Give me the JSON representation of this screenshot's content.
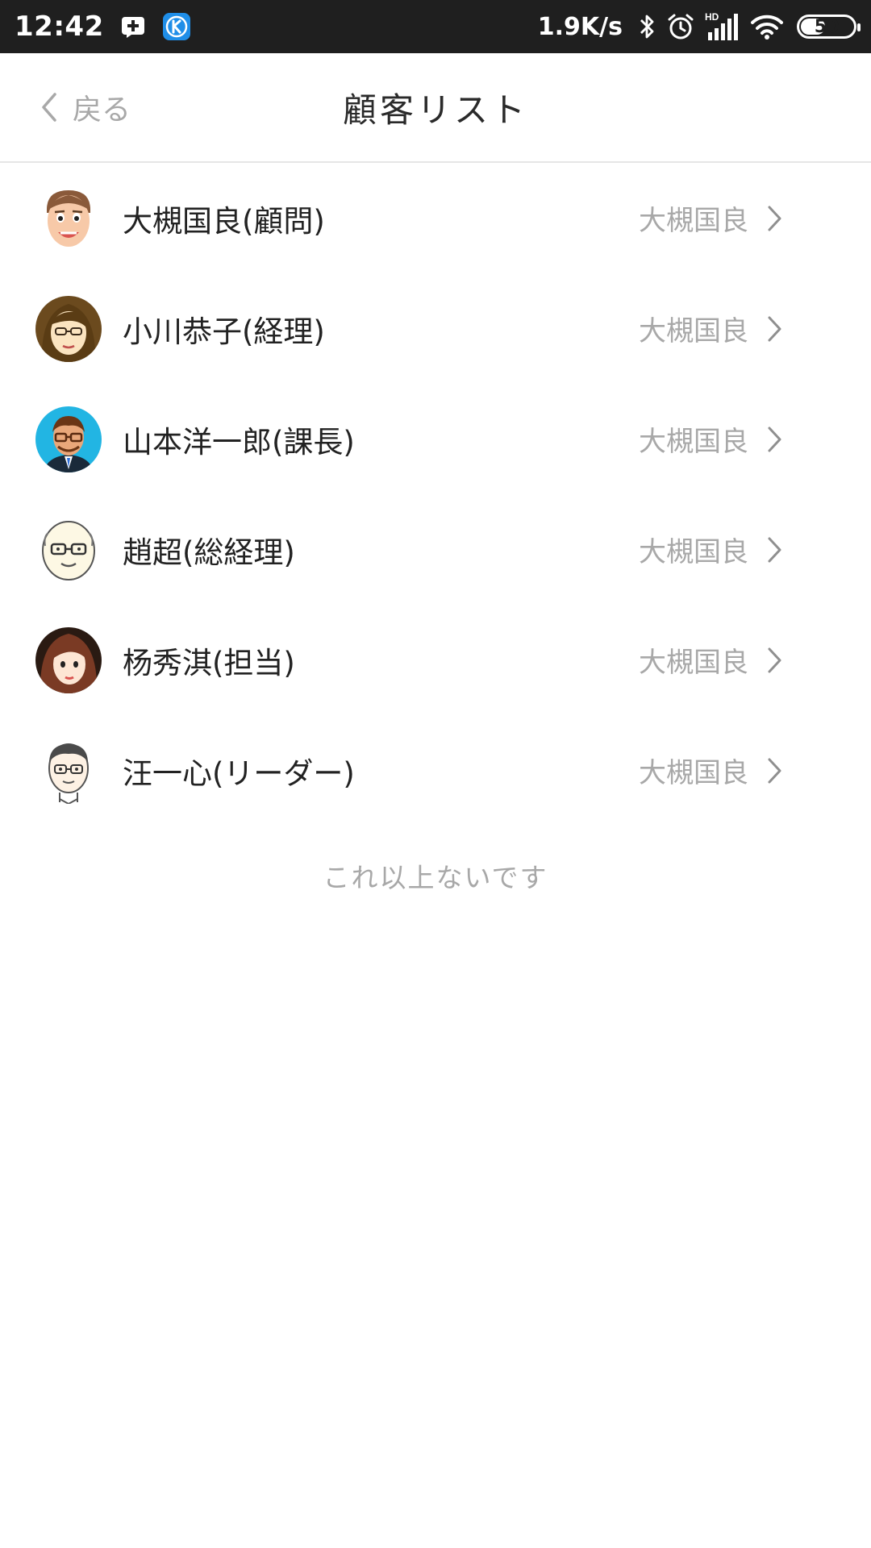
{
  "status_bar": {
    "time": "12:42",
    "net_speed": "1.9K/s",
    "network_badge": "HD",
    "battery_level": 50,
    "battery_text": "50",
    "icons": [
      "notification-plus-icon",
      "k-app-icon",
      "bluetooth-icon",
      "alarm-icon",
      "signal-icon",
      "wifi-icon",
      "battery-icon"
    ]
  },
  "nav": {
    "back_label": "戻る",
    "title": "顧客リスト"
  },
  "customers": [
    {
      "name": "大槻国良(顧問)",
      "owner": "大槻国良",
      "avatar": "male-bald-icon"
    },
    {
      "name": "小川恭子(経理)",
      "owner": "大槻国良",
      "avatar": "female-glasses-icon"
    },
    {
      "name": "山本洋一郎(課長)",
      "owner": "大槻国良",
      "avatar": "male-business-icon"
    },
    {
      "name": "趙超(総経理)",
      "owner": "大槻国良",
      "avatar": "elder-male-icon"
    },
    {
      "name": "杨秀淇(担当)",
      "owner": "大槻国良",
      "avatar": "female-longhair-icon"
    },
    {
      "name": "汪一心(リーダー)",
      "owner": "大槻国良",
      "avatar": "male-glasses-icon"
    }
  ],
  "list_end_text": "これ以上ないです",
  "colors": {
    "status_bar_bg": "#1f1f1f",
    "title_text": "#2a2a2a",
    "muted_text": "#a8a8a8",
    "divider": "#e6e6e6",
    "k_badge": "#1f8ee8"
  }
}
